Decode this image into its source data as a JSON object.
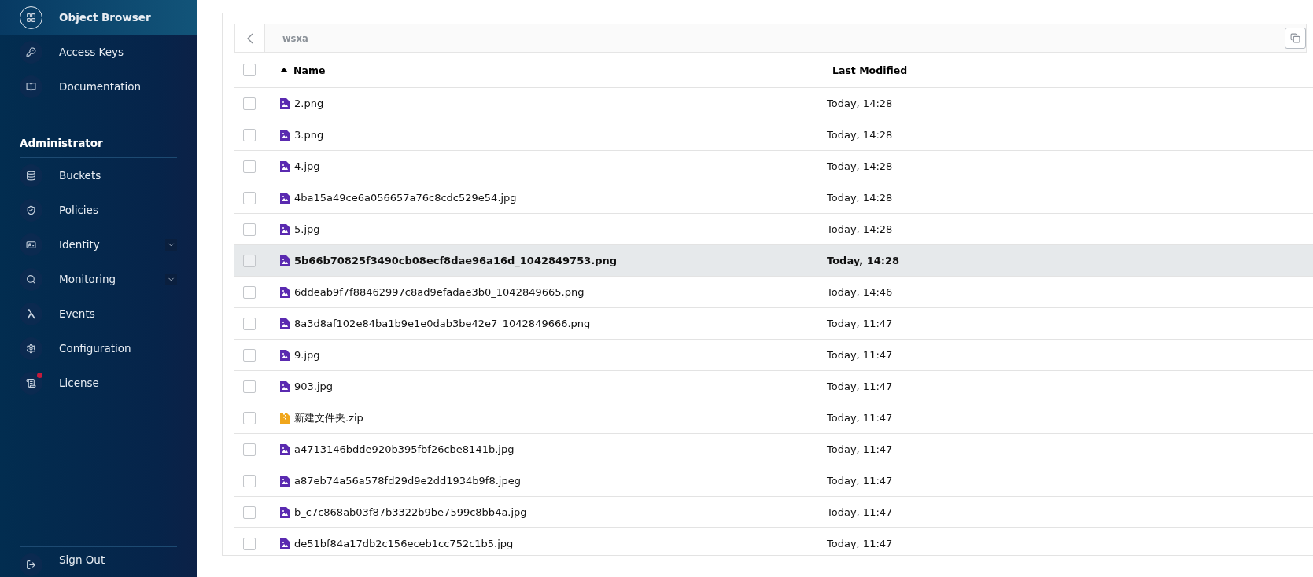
{
  "sidebar": {
    "items": [
      {
        "label": "Object Browser",
        "selected": true,
        "expandable": false,
        "alert": false
      },
      {
        "label": "Access Keys",
        "selected": false,
        "expandable": false,
        "alert": false
      },
      {
        "label": "Documentation",
        "selected": false,
        "expandable": false,
        "alert": false
      }
    ],
    "section_title": "Administrator",
    "admin_items": [
      {
        "label": "Buckets",
        "selected": false,
        "expandable": false,
        "alert": false
      },
      {
        "label": "Policies",
        "selected": false,
        "expandable": false,
        "alert": false
      },
      {
        "label": "Identity",
        "selected": false,
        "expandable": true,
        "alert": false
      },
      {
        "label": "Monitoring",
        "selected": false,
        "expandable": true,
        "alert": false
      },
      {
        "label": "Events",
        "selected": false,
        "expandable": false,
        "alert": false
      },
      {
        "label": "Configuration",
        "selected": false,
        "expandable": false,
        "alert": false
      },
      {
        "label": "License",
        "selected": false,
        "expandable": false,
        "alert": true
      }
    ],
    "sign_out": "Sign Out"
  },
  "breadcrumb": {
    "path": "wsxa"
  },
  "table": {
    "select_all": {
      "checked": false
    },
    "columns": [
      {
        "label": "Name",
        "sorted": true
      },
      {
        "label": "Last Modified",
        "sorted": false
      }
    ],
    "rows": [
      {
        "name": "2.png",
        "modified": "Today, 14:28",
        "kind": "image",
        "selected": false,
        "checked": false
      },
      {
        "name": "3.png",
        "modified": "Today, 14:28",
        "kind": "image",
        "selected": false,
        "checked": false
      },
      {
        "name": "4.jpg",
        "modified": "Today, 14:28",
        "kind": "image",
        "selected": false,
        "checked": false
      },
      {
        "name": "4ba15a49ce6a056657a76c8cdc529e54.jpg",
        "modified": "Today, 14:28",
        "kind": "image",
        "selected": false,
        "checked": false
      },
      {
        "name": "5.jpg",
        "modified": "Today, 14:28",
        "kind": "image",
        "selected": false,
        "checked": false
      },
      {
        "name": "5b66b70825f3490cb08ecf8dae96a16d_1042849753.png",
        "modified": "Today, 14:28",
        "kind": "image",
        "selected": true,
        "checked": false
      },
      {
        "name": "6ddeab9f7f88462997c8ad9efadae3b0_1042849665.png",
        "modified": "Today, 14:46",
        "kind": "image",
        "selected": false,
        "checked": false
      },
      {
        "name": "8a3d8af102e84ba1b9e1e0dab3be42e7_1042849666.png",
        "modified": "Today, 11:47",
        "kind": "image",
        "selected": false,
        "checked": false
      },
      {
        "name": "9.jpg",
        "modified": "Today, 11:47",
        "kind": "image",
        "selected": false,
        "checked": false
      },
      {
        "name": "903.jpg",
        "modified": "Today, 11:47",
        "kind": "image",
        "selected": false,
        "checked": false
      },
      {
        "name": "新建文件夹.zip",
        "modified": "Today, 11:47",
        "kind": "archive",
        "selected": false,
        "checked": false
      },
      {
        "name": "a4713146bdde920b395fbf26cbe8141b.jpg",
        "modified": "Today, 11:47",
        "kind": "image",
        "selected": false,
        "checked": false
      },
      {
        "name": "a87eb74a56a578fd29d9e2dd1934b9f8.jpeg",
        "modified": "Today, 11:47",
        "kind": "image",
        "selected": false,
        "checked": false
      },
      {
        "name": "b_c7c868ab03f87b3322b9be7599c8bb4a.jpg",
        "modified": "Today, 11:47",
        "kind": "image",
        "selected": false,
        "checked": false
      },
      {
        "name": "de51bf84a17db2c156eceb1cc752c1b5.jpg",
        "modified": "Today, 11:47",
        "kind": "image",
        "selected": false,
        "checked": false
      }
    ]
  }
}
